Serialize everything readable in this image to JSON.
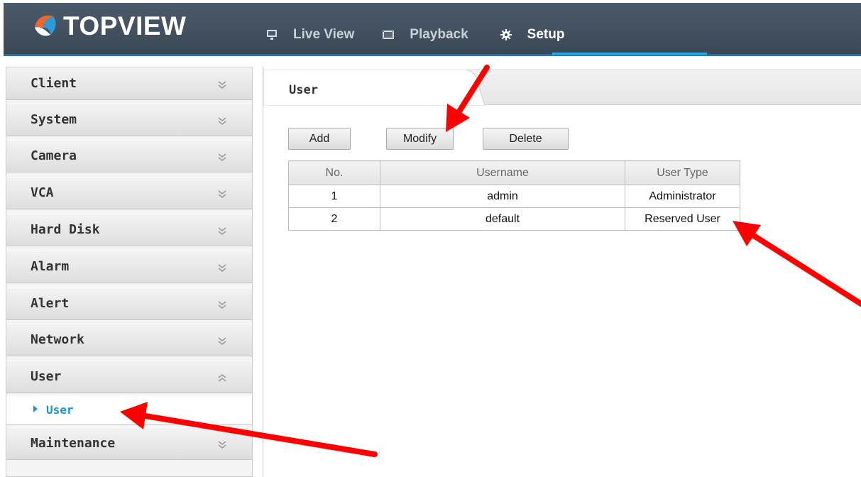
{
  "header": {
    "brand": "TOPVIEW",
    "nav": [
      {
        "label": "Live View",
        "icon": "monitor-icon"
      },
      {
        "label": "Playback",
        "icon": "film-icon"
      },
      {
        "label": "Setup",
        "icon": "gear-icon",
        "active": true
      }
    ]
  },
  "sidebar": {
    "items": [
      {
        "label": "Client",
        "state": "collapsed"
      },
      {
        "label": "System",
        "state": "collapsed"
      },
      {
        "label": "Camera",
        "state": "collapsed"
      },
      {
        "label": "VCA",
        "state": "collapsed"
      },
      {
        "label": "Hard Disk",
        "state": "collapsed"
      },
      {
        "label": "Alarm",
        "state": "collapsed"
      },
      {
        "label": "Alert",
        "state": "collapsed"
      },
      {
        "label": "Network",
        "state": "collapsed"
      },
      {
        "label": "User",
        "state": "expanded"
      },
      {
        "label": "Maintenance",
        "state": "collapsed"
      }
    ],
    "submenu": {
      "label": "User",
      "selected": true
    }
  },
  "main": {
    "tab": "User",
    "buttons": {
      "add": "Add",
      "modify": "Modify",
      "delete": "Delete"
    },
    "table": {
      "headers": [
        "No.",
        "Username",
        "User Type"
      ],
      "rows": [
        [
          "1",
          "admin",
          "Administrator"
        ],
        [
          "2",
          "default",
          "Reserved User"
        ]
      ]
    }
  },
  "colors": {
    "header_bg": "#444f5c",
    "accent_blue": "#1fa7e0",
    "submenu_text": "#1a93d6",
    "annotation_red": "#ff0000"
  }
}
